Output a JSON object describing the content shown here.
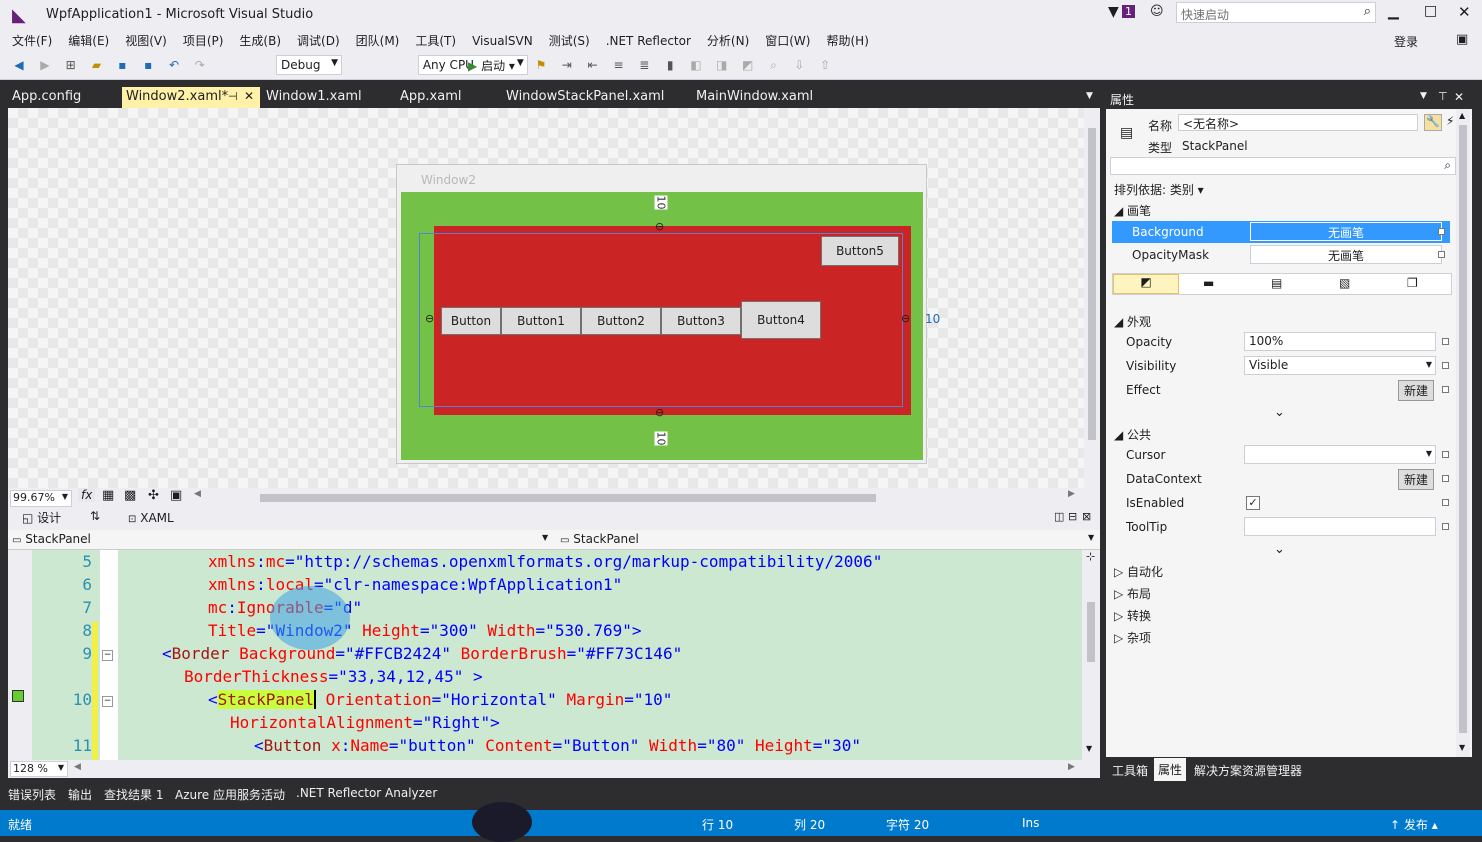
{
  "title": {
    "app": "WpfApplication1 - Microsoft Visual Studio",
    "notif_count": "1",
    "quick_launch_placeholder": "快速启动",
    "login": "登录"
  },
  "menu": [
    "文件(F)",
    "编辑(E)",
    "视图(V)",
    "项目(P)",
    "生成(B)",
    "调试(D)",
    "团队(M)",
    "工具(T)",
    "VisualSVN",
    "测试(S)",
    ".NET Reflector",
    "分析(N)",
    "窗口(W)",
    "帮助(H)"
  ],
  "toolbar": {
    "config": "Debug",
    "platform": "Any CPU",
    "start_label": "启动"
  },
  "tabs": [
    "App.config",
    "Window2.xaml*",
    "Window1.xaml",
    "App.xaml",
    "WindowStackPanel.xaml",
    "MainWindow.xaml"
  ],
  "designer": {
    "window_title": "Window2",
    "buttons": [
      "Button",
      "Button1",
      "Button2",
      "Button3",
      "Button4",
      "Button5"
    ],
    "margin_top": "10",
    "margin_right": "10",
    "margin_bottom": "10",
    "zoom": "99.67%",
    "tab_design": "设计",
    "tab_xaml": "XAML"
  },
  "path": {
    "left": "StackPanel",
    "right": "StackPanel"
  },
  "code": {
    "zoom": "128 %",
    "lines": [
      {
        "num": "5",
        "text": "xmlns:mc=\"http://schemas.openxmlformats.org/markup-compatibility/2006\""
      },
      {
        "num": "6",
        "text": "xmlns:local=\"clr-namespace:WpfApplication1\""
      },
      {
        "num": "7",
        "text": "mc:Ignorable=\"d\""
      },
      {
        "num": "8",
        "text": "Title=\"Window2\" Height=\"300\" Width=\"530.769\">"
      },
      {
        "num": "9",
        "text": "<Border Background=\"#FFCB2424\" BorderBrush=\"#FF73C146\""
      },
      {
        "num": "",
        "text": "BorderThickness=\"33,34,12,45\" >"
      },
      {
        "num": "10",
        "text": "<StackPanel Orientation=\"Horizontal\" Margin=\"10\""
      },
      {
        "num": "",
        "text": "HorizontalAlignment=\"Right\">"
      },
      {
        "num": "11",
        "text": "<Button x:Name=\"button\" Content=\"Button\" Width=\"80\" Height=\"30\""
      }
    ]
  },
  "bottom_tabs": [
    "错误列表",
    "输出",
    "查找结果 1",
    "Azure 应用服务活动",
    ".NET Reflector Analyzer"
  ],
  "status": {
    "ready": "就绪",
    "row": "行 10",
    "col": "列 20",
    "char": "字符 20",
    "ins": "Ins",
    "publish": "发布"
  },
  "properties": {
    "title": "属性",
    "name_label": "名称",
    "name_value": "<无名称>",
    "type_label": "类型",
    "type_value": "StackPanel",
    "sort_label": "排列依据: 类别",
    "sec_brush": "画笔",
    "background_label": "Background",
    "background_value": "无画笔",
    "opacitymask_label": "OpacityMask",
    "opacitymask_value": "无画笔",
    "sec_appearance": "外观",
    "opacity_label": "Opacity",
    "opacity_value": "100%",
    "visibility_label": "Visibility",
    "visibility_value": "Visible",
    "effect_label": "Effect",
    "new_label": "新建",
    "sec_common": "公共",
    "cursor_label": "Cursor",
    "datacontext_label": "DataContext",
    "isenabled_label": "IsEnabled",
    "tooltip_label": "ToolTip",
    "sec_automation": "自动化",
    "sec_layout": "布局",
    "sec_transform": "转换",
    "sec_misc": "杂项",
    "tabs": [
      "工具箱",
      "属性",
      "解决方案资源管理器"
    ]
  },
  "colors": {
    "accent": "#007acc",
    "border_bg": "#CB2424",
    "border_brush": "#73C146",
    "selected_row": "#3399ff"
  }
}
